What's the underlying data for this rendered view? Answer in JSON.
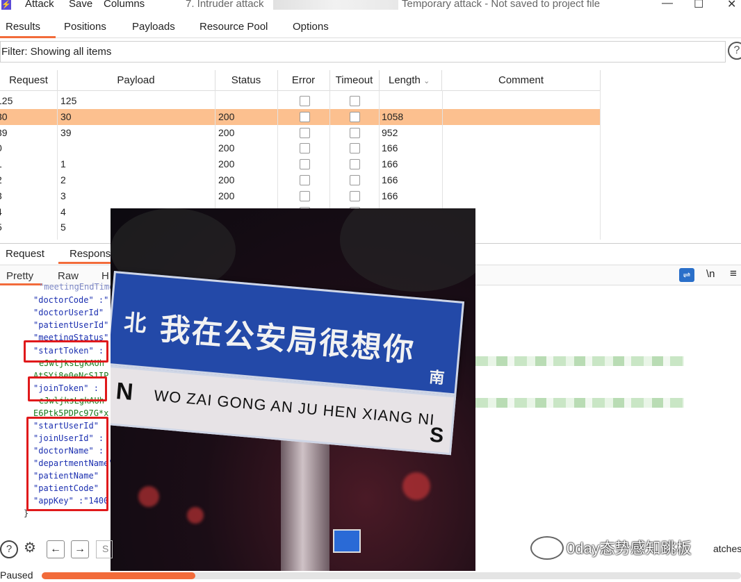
{
  "titlebar": {
    "menus": [
      "Attack",
      "Save",
      "Columns"
    ],
    "title_left": "7. Intruder attack",
    "title_right": "Temporary attack - Not saved to project file"
  },
  "tabs": [
    "Results",
    "Positions",
    "Payloads",
    "Resource Pool",
    "Options"
  ],
  "filter": {
    "text": "Filter: Showing all items"
  },
  "table": {
    "headers": [
      "Request",
      "Payload",
      "Status",
      "Error",
      "Timeout",
      "Length",
      "Comment"
    ],
    "rows": [
      {
        "request": "125",
        "payload": "125",
        "status": "",
        "length": ""
      },
      {
        "request": "30",
        "payload": "30",
        "status": "200",
        "length": "1058",
        "selected": true
      },
      {
        "request": "39",
        "payload": "39",
        "status": "200",
        "length": "952"
      },
      {
        "request": "0",
        "payload": "",
        "status": "200",
        "length": "166"
      },
      {
        "request": "1",
        "payload": "1",
        "status": "200",
        "length": "166"
      },
      {
        "request": "2",
        "payload": "2",
        "status": "200",
        "length": "166"
      },
      {
        "request": "3",
        "payload": "3",
        "status": "200",
        "length": "166"
      },
      {
        "request": "4",
        "payload": "4",
        "status": "",
        "length": ""
      },
      {
        "request": "5",
        "payload": "5",
        "status": "",
        "length": ""
      }
    ]
  },
  "reqresp_tabs": [
    "Request",
    "Response"
  ],
  "view_tabs": [
    "Pretty",
    "Raw",
    "H"
  ],
  "view_icons": {
    "newline": "\\n",
    "menu": "≡"
  },
  "code": {
    "top_partial": "\"meetingEndTime\"",
    "keys": [
      "\"doctorCode\" :\"",
      "\"doctorUserId\"",
      "\"patientUserId\"",
      "\"meetingStatus\"",
      "\"startToken\" :",
      "\"joinToken\" :",
      "\"startUserId\"",
      "\"joinUserId\" :",
      "\"doctorName\" :",
      "\"departmentName\"",
      "\"patientName\"",
      "\"patientCode\"",
      "\"appKey\" :\"1400"
    ],
    "value_lines": [
      "eJwljksLgkAUh",
      "AtSYi8e0eNcS1IP",
      "eJwljksLgkAUh",
      "E6Ptk5PDPc97G*x"
    ],
    "closing_brace": "}"
  },
  "photo": {
    "sign_chinese": "我在公安局很想你",
    "sign_north_cn": "北",
    "sign_south_cn": "南",
    "sign_pinyin": "WO ZAI GONG AN JU HEN XIANG NI",
    "sign_n": "N",
    "sign_s": "S"
  },
  "statusbar": {
    "help": "?",
    "back": "←",
    "forward": "→",
    "input_partial": "S",
    "matches_partial": "atches",
    "watermark": "0day态势感知跳板",
    "paused": "Paused",
    "progress_fraction": 0.22,
    "accent": "#f26b3a"
  }
}
